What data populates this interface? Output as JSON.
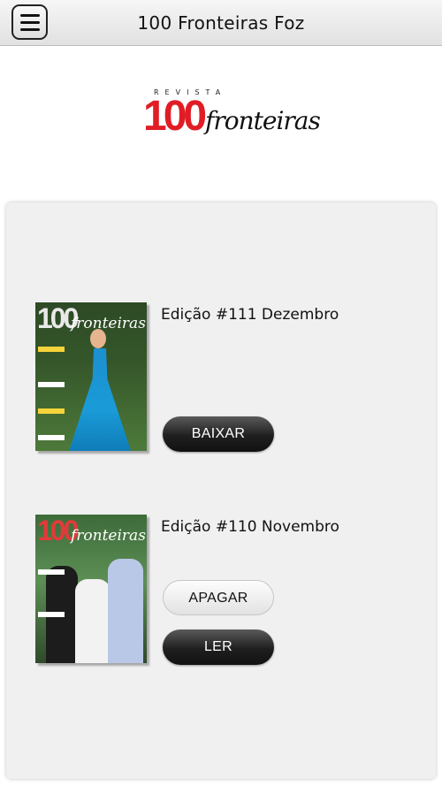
{
  "header": {
    "title": "100 Fronteiras Foz",
    "menu_icon": "hamburger-menu-icon"
  },
  "logo": {
    "revista": "REVISTA",
    "number": "100",
    "script": "fronteiras"
  },
  "issues": [
    {
      "title": "Edição #111 Dezembro",
      "cover_masthead": "100",
      "cover_script": "fronteiras",
      "buttons": [
        {
          "label": "BAIXAR",
          "style": "dark"
        }
      ]
    },
    {
      "title": "Edição #110 Novembro",
      "cover_masthead": "100",
      "cover_script": "fronteiras",
      "buttons": [
        {
          "label": "APAGAR",
          "style": "light"
        },
        {
          "label": "LER",
          "style": "dark"
        }
      ]
    }
  ],
  "colors": {
    "brand_red": "#e01d26",
    "panel_bg": "#f0f0f0",
    "button_dark": "#1f1f1f"
  }
}
